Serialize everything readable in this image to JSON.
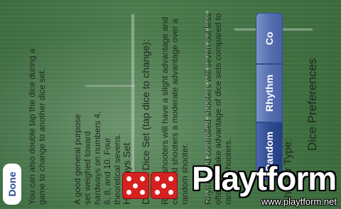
{
  "screen": {
    "title": "Dice Preferences",
    "shooter_type_label": "Shooter Type:",
    "shooter_options": [
      {
        "label": "Random",
        "selected": true
      },
      {
        "label": "Rhythm",
        "selected": false
      },
      {
        "label": "Co",
        "selected": false
      }
    ],
    "description_1": "Rhythm and controlled shooters will seven out less often and take advantage of dice sets compared to random shooters.",
    "description_2": "Rhythm shooters will have a slight advantage and controlled shooters a moderate advantage over a random shooter.",
    "default_dice_set_label": "Default Dice Set (tap dice to change):",
    "dice_set_name": "Hardways Set",
    "dice_set_description": "A good general purpose set weighed toward hardways on numbers 4, 6, 8, and 10. Four theoretical sevens.",
    "double_tap_note": "You can also double tap the dice during a game to change to another dice set.",
    "done_label": "Done",
    "accent_color": "#2f4c92"
  },
  "watermark": {
    "logo_text": "Playtform",
    "url_text": "www.playtform.net"
  }
}
